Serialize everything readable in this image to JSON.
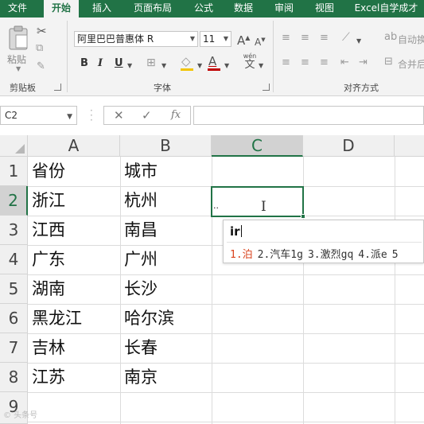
{
  "tabs": [
    {
      "label": "文件",
      "active": false
    },
    {
      "label": "开始",
      "active": true
    },
    {
      "label": "插入",
      "active": false
    },
    {
      "label": "页面布局",
      "active": false
    },
    {
      "label": "公式",
      "active": false
    },
    {
      "label": "数据",
      "active": false
    },
    {
      "label": "审阅",
      "active": false
    },
    {
      "label": "视图",
      "active": false
    },
    {
      "label": "Excel自学成才",
      "active": false
    }
  ],
  "ribbon": {
    "clipboard": {
      "paste_label": "粘贴",
      "group_label": "剪贴板"
    },
    "font": {
      "font_name": "阿里巴巴普惠体 R",
      "font_size": "11",
      "group_label": "字体",
      "bold": "B",
      "italic": "I",
      "underline": "U",
      "wen_label": "wén",
      "wen_char": "文"
    },
    "align": {
      "group_label": "对齐方式",
      "wrap_label": "自动换",
      "merge_label": "合并后"
    }
  },
  "formula_bar": {
    "name_box": "C2",
    "cancel": "✕",
    "enter": "✓",
    "fx": "fx",
    "content": ""
  },
  "sheet": {
    "columns": [
      "A",
      "B",
      "C",
      "D"
    ],
    "rows": [
      {
        "num": "1",
        "a": "省份",
        "b": "城市"
      },
      {
        "num": "2",
        "a": "浙江",
        "b": "杭州"
      },
      {
        "num": "3",
        "a": "江西",
        "b": "南昌"
      },
      {
        "num": "4",
        "a": "广东",
        "b": "广州"
      },
      {
        "num": "5",
        "a": "湖南",
        "b": "长沙"
      },
      {
        "num": "6",
        "a": "黑龙江",
        "b": "哈尔滨"
      },
      {
        "num": "7",
        "a": "吉林",
        "b": "长春"
      },
      {
        "num": "8",
        "a": "江苏",
        "b": "南京"
      },
      {
        "num": "9",
        "a": "",
        "b": ""
      }
    ],
    "selected_cell": "C2"
  },
  "ime": {
    "input": "ir",
    "candidates": [
      "1.泊",
      "2.汽车1g",
      "3.激烈gq",
      "4.派e",
      "5"
    ]
  },
  "watermark": "© 头条号"
}
